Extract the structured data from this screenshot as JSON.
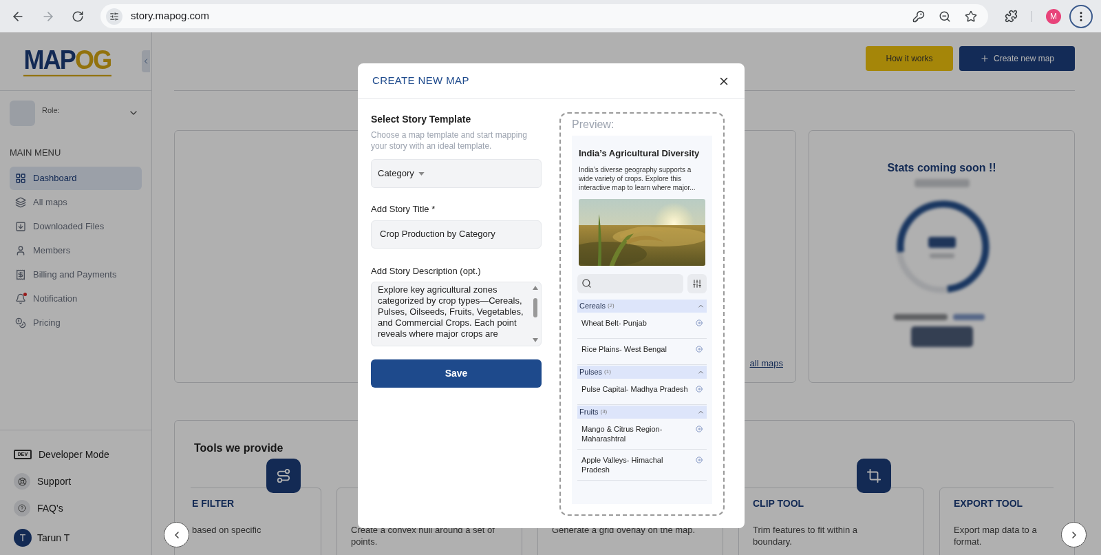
{
  "browser": {
    "url": "story.mapog.com",
    "forward_disabled": true,
    "profile_initial": "M"
  },
  "sidebar": {
    "logo": {
      "main": "MAP",
      "accent": "OG"
    },
    "role_label": "Role:",
    "menu_heading": "MAIN MENU",
    "items": [
      {
        "label": "Dashboard",
        "selected": true,
        "alert": false
      },
      {
        "label": "All maps",
        "selected": false,
        "alert": false
      },
      {
        "label": "Downloaded Files",
        "selected": false,
        "alert": false
      },
      {
        "label": "Members",
        "selected": false,
        "alert": false
      },
      {
        "label": "Billing and Payments",
        "selected": false,
        "alert": false
      },
      {
        "label": "Notification",
        "selected": false,
        "alert": true
      },
      {
        "label": "Pricing",
        "selected": false,
        "alert": false
      }
    ],
    "footer_items": [
      {
        "label": "Developer Mode",
        "badge": "DEV"
      },
      {
        "label": "Support"
      },
      {
        "label": "FAQ's"
      }
    ],
    "user": {
      "initial": "T",
      "name": "Tarun T"
    }
  },
  "header": {
    "buttons": [
      {
        "label": "How it works",
        "kind": "secondary"
      },
      {
        "label": "Create new map",
        "kind": "primary"
      }
    ]
  },
  "maps_card": {
    "link": "all maps"
  },
  "stats_card": {
    "title": "Stats coming soon !!"
  },
  "tools": {
    "title": "Tools we provide",
    "cards": [
      {
        "title": "E FILTER",
        "description": "based on specific"
      },
      {
        "description": "Create a convex hull around a set of points."
      },
      {
        "description": "Generate a grid overlay on the map."
      },
      {
        "title": "CLIP TOOL",
        "description": "Trim features to fit within a boundary."
      },
      {
        "title": "EXPORT TOOL",
        "description": "Export map data to a format."
      }
    ]
  },
  "modal": {
    "title": "CREATE NEW MAP",
    "template": {
      "label": "Select Story Template",
      "hint": "Choose a map template and start mapping your story with an ideal template.",
      "value": "Category"
    },
    "title_field": {
      "label": "Add Story Title *",
      "value": "Crop Production by Category"
    },
    "description_field": {
      "label": "Add Story Description (opt.)",
      "value": "Explore key agricultural zones categorized by crop types—Cereals, Pulses, Oilseeds, Fruits, Vegetables, and Commercial Crops. Each point reveals where major crops are"
    },
    "save": "Save",
    "preview": {
      "label": "Preview:",
      "title": "India’s Agricultural Diversity",
      "description": "India’s diverse geography supports a wide variety of crops. Explore this interactive map to learn where major...",
      "groups": [
        {
          "name": "Cereals",
          "count": "(2)",
          "expanded": true,
          "items": [
            "Wheat Belt- Punjab",
            "Rice Plains- West Bengal"
          ]
        },
        {
          "name": "Pulses",
          "count": "(1)",
          "expanded": true,
          "items": [
            "Pulse Capital- Madhya Pradesh"
          ]
        },
        {
          "name": "Fruits",
          "count": "(3)",
          "expanded": true,
          "items": [
            "Mango & Citrus Region- Maharashtral",
            "Apple Valleys- Himachal Pradesh"
          ]
        }
      ]
    }
  }
}
